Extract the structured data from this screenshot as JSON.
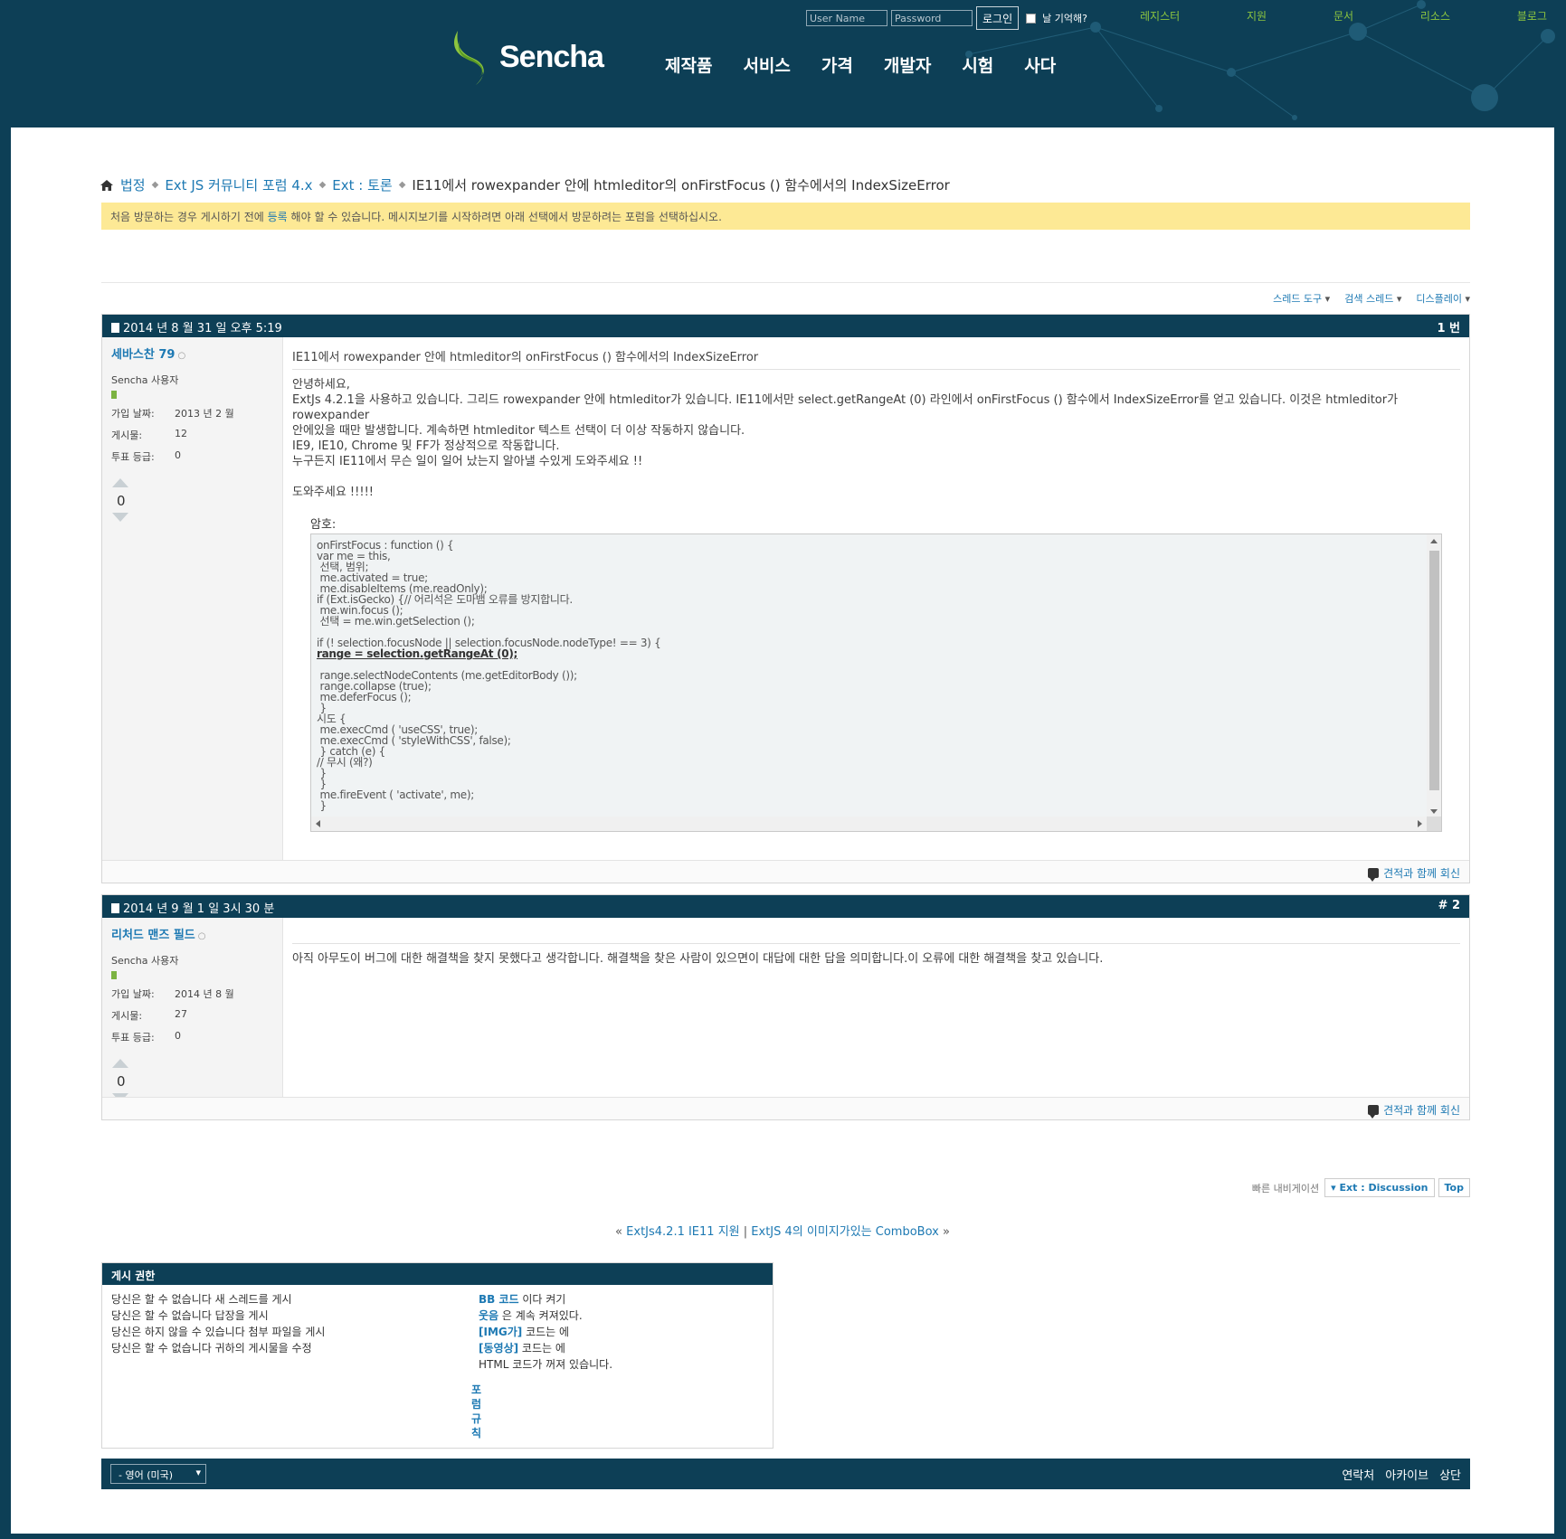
{
  "header": {
    "login": {
      "username_placeholder": "User Name",
      "password_placeholder": "Password",
      "button": "로그인",
      "remember": "날 기억해?"
    },
    "top_links": [
      "레지스터",
      "지원",
      "문서",
      "리소스",
      "블로그"
    ],
    "logo": "Sencha",
    "nav": [
      "제작품",
      "서비스",
      "가격",
      "개발자",
      "시험",
      "사다"
    ]
  },
  "breadcrumb": {
    "items": [
      "법정",
      "Ext JS 커뮤니티 포럼 4.x",
      "Ext : 토론"
    ],
    "current": "IE11에서 rowexpander 안에 htmleditor의 onFirstFocus () 함수에서의 IndexSizeError"
  },
  "notice": {
    "before": "처음 방문하는 경우 게시하기 전에 ",
    "link": "등록",
    "after": " 해야 할 수 있습니다. 메시지보기를 시작하려면 아래 선택에서 방문하려는 포럼을 선택하십시오."
  },
  "thread_tools": [
    "스레드 도구",
    "검색 스레드",
    "디스플레이"
  ],
  "posts": [
    {
      "date": "2014 년 8 월 31 일  오후 5:19",
      "number": "1 번",
      "username": "세바스찬 79",
      "status": "○",
      "role": "Sencha 사용자",
      "join_label": "가입 날짜:",
      "join_value": "2013 년 2 월",
      "posts_label": "게시물:",
      "posts_value": "12",
      "vote_label": "투표 등급:",
      "vote_value": "0",
      "vote_count": "0",
      "title": "IE11에서 rowexpander 안에 htmleditor의 onFirstFocus () 함수에서의 IndexSizeError",
      "text_lines": [
        "안녕하세요,",
        "ExtJs 4.2.1을 사용하고 있습니다. 그리드 rowexpander 안에 htmleditor가 있습니다. IE11에서만 select.getRangeAt (0) 라인에서 onFirstFocus () 함수에서 IndexSizeError를 얻고 있습니다. 이것은 htmleditor가 rowexpander",
        "안에있을 때만 발생합니다. 계속하면 htmleditor 텍스트 선택이 더 이상 작동하지 않습니다.",
        "IE9, IE10, Chrome 및 FF가 정상적으로 작동합니다.",
        "누구든지 IE11에서 무슨 일이 일어 났는지 알아낼 수있게 도와주세요 !!",
        "",
        "도와주세요 !!!!!"
      ],
      "code_label": "암호:",
      "code_before": "onFirstFocus : function () {\nvar me = this,\n 선택, 범위;\n me.activated = true;\n me.disableItems (me.readOnly);\nif (Ext.isGecko) {// 어리석은 도마뱀 오류를 방지합니다.\n me.win.focus ();\n 선택 = me.win.getSelection ();\n\nif (! selection.focusNode || selection.focusNode.nodeType! == 3) {\n",
      "code_highlight": "range = selection.getRangeAt (0);",
      "code_after": "\n\n range.selectNodeContents (me.getEditorBody ());\n range.collapse (true);\n me.deferFocus ();\n }\n시도 {\n me.execCmd ( 'useCSS', true);\n me.execCmd ( 'styleWithCSS', false);\n } catch (e) {\n// 무시 (왜?)\n }\n }\n me.fireEvent ( 'activate', me);\n }",
      "reply": "견적과 함께 회신"
    },
    {
      "date": "2014 년 9 월 1 일  3시 30 분",
      "number": "# 2",
      "username": "리처드 맨즈 필드",
      "status": "○",
      "role": "Sencha 사용자",
      "join_label": "가입 날짜:",
      "join_value": "2014 년 8 월",
      "posts_label": "게시물:",
      "posts_value": "27",
      "vote_label": "투표 등급:",
      "vote_value": "0",
      "vote_count": "0",
      "title": "",
      "text": "아직 아무도이 버그에 대한 해결책을 찾지 못했다고 생각합니다. 해결책을 찾은 사람이 있으면이 대답에 대한 답을 의미합니다.이 오류에 대한 해결책을 찾고 있습니다.",
      "reply": "견적과 함께 회신"
    }
  ],
  "quick_nav": {
    "label": "빠른 내비게이션",
    "forum": "Ext : Discussion",
    "top": "Top"
  },
  "prev_next": {
    "prev_mark": "«",
    "prev": "ExtJs4.2.1 IE11 지원",
    "sep": "|",
    "next": "ExtJS 4의 이미지가있는 ComboBox",
    "next_mark": "»"
  },
  "permissions": {
    "title": "게시 권한",
    "lines": [
      "당신은 할 수 없습니다 새 스레드를 게시",
      "당신은 할 수 없습니다 답장을 게시",
      "당신은 하지 않을 수 있습니다 첨부 파일을 게시",
      "당신은 할 수 없습니다 귀하의 게시물을 수정"
    ],
    "codes": [
      {
        "link": "BB 코드",
        "text": " 이다 켜기"
      },
      {
        "link": "웃음",
        "text": " 은 계속 켜져있다."
      },
      {
        "link": "[IMG가]",
        "text": " 코드는 에"
      },
      {
        "link": "[동영상]",
        "text": " 코드는 에"
      }
    ],
    "html_line": "HTML 코드가 꺼져 있습니다.",
    "rules": "포럼규칙"
  },
  "footer": {
    "language": "- 영어 (미국)",
    "links": [
      "연락처",
      "아카이브",
      "상단"
    ]
  },
  "colors": {
    "header_bg": "#0d3f56",
    "accent_green": "#8dc63f",
    "link_blue": "#1d79b3",
    "notice_bg": "#fde995"
  }
}
